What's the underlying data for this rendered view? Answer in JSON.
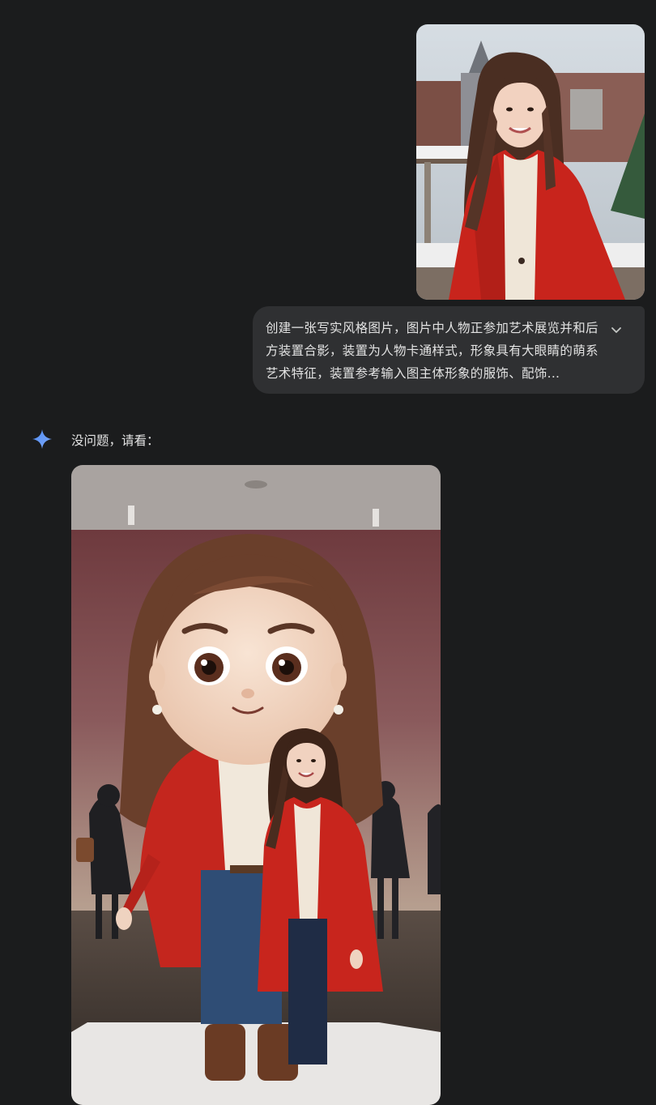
{
  "conversation": {
    "user_message": {
      "image_alt": "",
      "text": "创建一张写实风格图片，图片中人物正参加艺术展览并和后方装置合影，装置为人物卡通样式，形象具有大眼睛的萌系艺术特征，装置参考输入图主体形象的服饰、配饰...",
      "expand_icon": "chevron-down-icon"
    },
    "assistant_message": {
      "icon": "sparkle-icon",
      "text": "没问题，请看：",
      "image_alt": ""
    }
  },
  "colors": {
    "background": "#1b1c1d",
    "bubble": "#2f3032",
    "text": "#e3e3e3",
    "accent": "#4f8df5"
  }
}
